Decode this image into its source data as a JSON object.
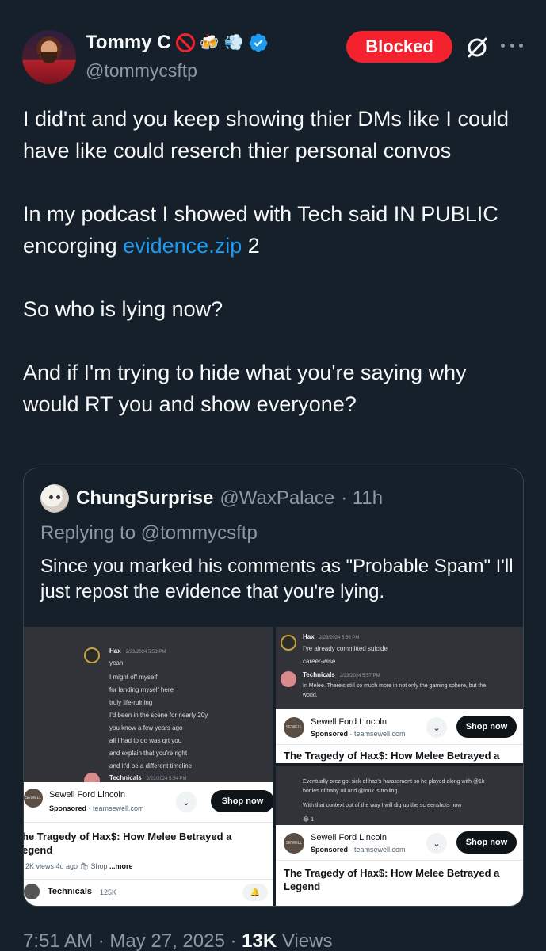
{
  "author": {
    "display_name": "Tommy C",
    "handle": "@tommycsftp",
    "emojis": [
      "🍻",
      "💨"
    ]
  },
  "actions": {
    "blocked_label": "Blocked"
  },
  "tweet": {
    "paragraphs": [
      "I did'nt and you keep showing thier DMs like I could have like could reserch thier personal convos",
      "In my podcast I showed with Tech said IN PUBLIC encorging",
      "So who is lying now?",
      "And if I'm trying to hide what you're saying  why would RT you and show everyone?"
    ],
    "link_text": "evidence.zip",
    "link_suffix": " 2"
  },
  "quote": {
    "display_name": "ChungSurprise",
    "handle": "@WaxPalace",
    "time": "· 11h",
    "replying_to": "Replying to @tommycsftp",
    "text": "Since you marked his comments as \"Probable Spam\" I'll just repost the evidence that you're lying."
  },
  "screenshot_left": {
    "user": "Hax",
    "time": "2/23/2024 5:53 PM",
    "lines": [
      "yeah",
      "I might off myself",
      "for landing myself here",
      "truly life-ruining",
      "I'd been in the scene for nearly 20y",
      "you know a few years ago",
      "all I had to do was qrt you",
      "and explain that you're right",
      "and it'd be a different timeline"
    ],
    "next_user": "Technicals",
    "next_time": "2/23/2024 5:54 PM",
    "ad_name": "Sewell Ford Lincoln",
    "ad_sponsored": "Sponsored",
    "ad_domain": "· teamsewell.com",
    "ad_shop": "Shop now",
    "ad_title_1": "he Tragedy of Hax$: How Melee Betrayed a",
    "ad_title_2": "egend",
    "video_meta": "2K views  4d ago  🛍 Shop",
    "video_more": "...more",
    "channel": "Technicals",
    "channel_subs": "125K"
  },
  "screenshot_right_top": {
    "user1": "Hax",
    "time1": "2/23/2024 5:56 PM",
    "line1": "I've already committed suicide",
    "line2": "career-wise",
    "user2": "Technicals",
    "time2": "2/23/2024 5:57 PM",
    "line3": "In Melee. There's still so much more in not only the gaming sphere, but the",
    "line4": "world.",
    "ad_name": "Sewell Ford Lincoln",
    "ad_sponsored": "Sponsored",
    "ad_domain": "· teamsewell.com",
    "ad_shop": "Shop now",
    "ad_title": "The Tragedy of Hax$: How Melee Betrayed a"
  },
  "screenshot_right_bottom": {
    "line1": "Eventually orez got sick of hax's harassment so he played along with @1k",
    "line2": "bottles of baby oil and @iouk 's trolling",
    "line3": "With that context out of the way I will dig up the screenshots now",
    "reaction": "1",
    "ad_name": "Sewell Ford Lincoln",
    "ad_sponsored": "Sponsored",
    "ad_domain": "· teamsewell.com",
    "ad_shop": "Shop now",
    "ad_title": "The Tragedy of Hax$: How Melee Betrayed a",
    "ad_title_2": "Legend"
  },
  "footer": {
    "time": "7:51 AM · May 27, 2025 ·",
    "views_count": "13K",
    "views_label": "Views"
  },
  "colors": {
    "background": "#15202b",
    "blocked": "#f4212e",
    "link": "#1d9bf0",
    "muted": "#8b98a5"
  }
}
